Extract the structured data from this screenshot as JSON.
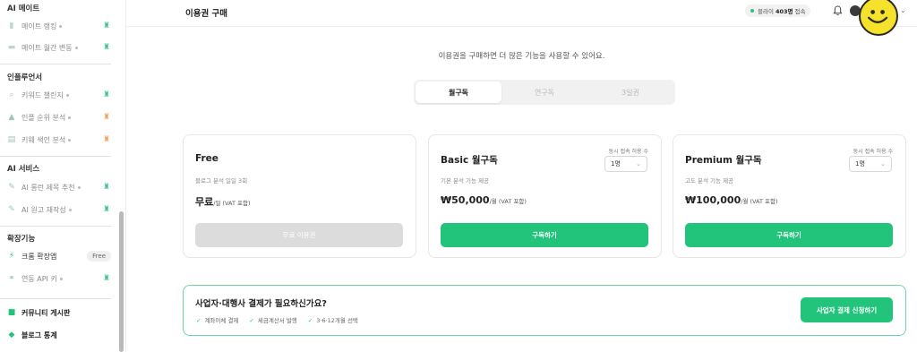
{
  "sidebar": {
    "sections": [
      {
        "heading": "AI 메이트",
        "items": [
          {
            "label": "메이트 랭킹",
            "icon": "bar-chart-icon",
            "badge": "shirt-green"
          },
          {
            "label": "메이트 월간 변동",
            "icon": "calendar-icon",
            "badge": "shirt-green"
          }
        ]
      },
      {
        "heading": "인플루언서",
        "items": [
          {
            "label": "키워드 챌린지",
            "icon": "search-icon",
            "badge": "shirt-green"
          },
          {
            "label": "인플 순위 분석",
            "icon": "chart-icon",
            "badge": "shirt-orange"
          },
          {
            "label": "키웨 색인 분석",
            "icon": "document-icon",
            "badge": "shirt-orange"
          }
        ]
      },
      {
        "heading": "AI 서비스",
        "items": [
          {
            "label": "AI 롱런 제목 추천",
            "icon": "sparkle-icon",
            "badge": "shirt-green"
          },
          {
            "label": "AI 원고 재작성",
            "icon": "pencil-icon",
            "badge": "shirt-green"
          }
        ]
      },
      {
        "heading": "확장기능",
        "items": [
          {
            "label": "크롬 확장앱",
            "icon": "extension-icon",
            "badge": "Free"
          },
          {
            "label": "연동 API 키",
            "icon": "link-icon",
            "badge": "shirt-green"
          }
        ]
      }
    ],
    "bottom_items": [
      {
        "label": "커뮤니티 게시판",
        "icon": "community-icon"
      },
      {
        "label": "블로그 통계",
        "icon": "cube-icon"
      }
    ]
  },
  "header": {
    "title": "이용권 구매",
    "online_prefix": "블라이",
    "online_count": "403명",
    "online_suffix": "접속",
    "icons": [
      "bell-icon",
      "avatar",
      "chevron-down-icon"
    ]
  },
  "main": {
    "intro": "이용권을 구매하면 더 많은 기능을 사용할 수 있어요.",
    "tabs": [
      {
        "label": "월구독",
        "active": true
      },
      {
        "label": "연구독",
        "active": false
      },
      {
        "label": "3일권",
        "active": false
      }
    ],
    "plans": [
      {
        "name": "Free",
        "desc": "블로그 분석 일일 3회",
        "price": "무료",
        "unit": "/일 (VAT 포함)",
        "button": "무료 이용권",
        "button_disabled": true
      },
      {
        "name": "Basic 월구독",
        "desc": "기본 분석 기능 제공",
        "price": "₩50,000",
        "unit": "/월 (VAT 포함)",
        "button": "구독하기",
        "seat_label": "동시 접속 허용 수",
        "seat_value": "1명"
      },
      {
        "name": "Premium 월구독",
        "desc": "고도 분석 기능 제공",
        "price": "₩100,000",
        "unit": "/월 (VAT 포함)",
        "button": "구독하기",
        "seat_label": "동시 접속 허용 수",
        "seat_value": "1명"
      }
    ],
    "business": {
      "title": "사업자·대행사 결제가 필요하신가요?",
      "features": [
        "계좌이체 결제",
        "세금계산서 발행",
        "3·6·12개월 선택"
      ],
      "button": "사업자 결제 신청하기"
    }
  },
  "colors": {
    "accent": "#22c47c",
    "business_border": "#6fd7a6",
    "sticker": "#f7e22b"
  }
}
